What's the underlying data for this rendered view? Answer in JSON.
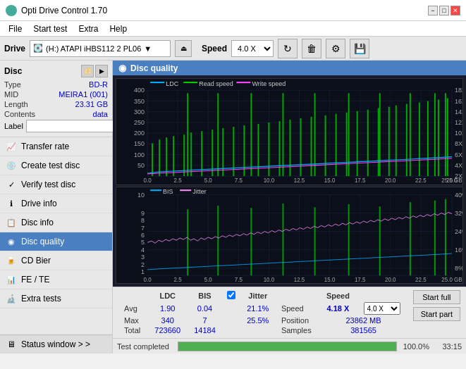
{
  "app": {
    "title": "Opti Drive Control 1.70",
    "icon": "●"
  },
  "title_controls": {
    "minimize": "−",
    "maximize": "□",
    "close": "✕"
  },
  "menu": {
    "items": [
      "File",
      "Start test",
      "Extra",
      "Help"
    ]
  },
  "drive_bar": {
    "drive_label": "Drive",
    "drive_value": "(H:) ATAPI iHBS112  2 PL06",
    "speed_label": "Speed",
    "speed_value": "4.0 X"
  },
  "disc": {
    "panel_title": "Disc",
    "type_label": "Type",
    "type_value": "BD-R",
    "mid_label": "MID",
    "mid_value": "MEIRA1 (001)",
    "length_label": "Length",
    "length_value": "23.31 GB",
    "contents_label": "Contents",
    "contents_value": "data",
    "label_label": "Label",
    "label_value": ""
  },
  "nav": {
    "items": [
      {
        "id": "transfer-rate",
        "label": "Transfer rate",
        "icon": "📈"
      },
      {
        "id": "create-test-disc",
        "label": "Create test disc",
        "icon": "💿"
      },
      {
        "id": "verify-test-disc",
        "label": "Verify test disc",
        "icon": "✓"
      },
      {
        "id": "drive-info",
        "label": "Drive info",
        "icon": "ℹ"
      },
      {
        "id": "disc-info",
        "label": "Disc info",
        "icon": "📋"
      },
      {
        "id": "disc-quality",
        "label": "Disc quality",
        "icon": "◉",
        "active": true
      },
      {
        "id": "cd-bier",
        "label": "CD Bier",
        "icon": "🍺"
      },
      {
        "id": "fe-te",
        "label": "FE / TE",
        "icon": "📊"
      },
      {
        "id": "extra-tests",
        "label": "Extra tests",
        "icon": "🔬"
      }
    ],
    "status_window": "Status window > >"
  },
  "panel": {
    "title": "Disc quality",
    "icon": "◉"
  },
  "chart1": {
    "legend": {
      "ldc": "LDC",
      "read": "Read speed",
      "write": "Write speed"
    },
    "y_left_max": 400,
    "y_right_max": 18,
    "x_max": 25,
    "x_labels": [
      "0.0",
      "2.5",
      "5.0",
      "7.5",
      "10.0",
      "12.5",
      "15.0",
      "17.5",
      "20.0",
      "22.5",
      "25.0"
    ],
    "y_right_labels": [
      "18X",
      "16X",
      "14X",
      "12X",
      "10X",
      "8X",
      "6X",
      "4X",
      "2X"
    ],
    "y_left_labels": [
      "400",
      "350",
      "300",
      "250",
      "200",
      "150",
      "100",
      "50"
    ]
  },
  "chart2": {
    "legend": {
      "bis": "BIS",
      "jitter": "Jitter"
    },
    "y_left_max": 10,
    "y_right_max": 40,
    "x_max": 25,
    "x_labels": [
      "0.0",
      "2.5",
      "5.0",
      "7.5",
      "10.0",
      "12.5",
      "15.0",
      "17.5",
      "20.0",
      "22.5",
      "25.0"
    ],
    "y_right_labels": [
      "40%",
      "32%",
      "24%",
      "16%",
      "8%"
    ]
  },
  "stats": {
    "headers": [
      "",
      "LDC",
      "BIS",
      "",
      "Jitter",
      "Speed",
      ""
    ],
    "avg_label": "Avg",
    "avg_ldc": "1.90",
    "avg_bis": "0.04",
    "avg_jitter": "21.1%",
    "avg_speed_label": "Speed",
    "avg_speed_value": "4.18 X",
    "avg_speed_select": "4.0 X",
    "max_label": "Max",
    "max_ldc": "340",
    "max_bis": "7",
    "max_jitter": "25.5%",
    "position_label": "Position",
    "position_value": "23862 MB",
    "total_label": "Total",
    "total_ldc": "723660",
    "total_bis": "14184",
    "samples_label": "Samples",
    "samples_value": "381565",
    "jitter_checked": true
  },
  "buttons": {
    "start_full": "Start full",
    "start_part": "Start part"
  },
  "progress": {
    "status": "Test completed",
    "percent": "100.0%",
    "time": "33:15"
  }
}
